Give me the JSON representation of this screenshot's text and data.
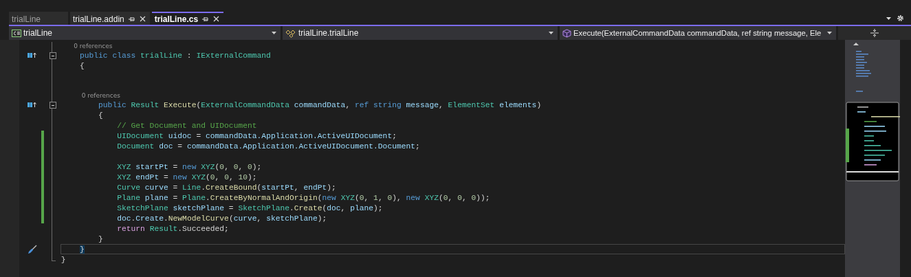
{
  "tabs": [
    {
      "label": "trialLine",
      "selected": false,
      "preview": true
    },
    {
      "label": "trialLine.addin",
      "selected": false,
      "preview": false
    },
    {
      "label": "trialLine.cs",
      "selected": true,
      "preview": false
    }
  ],
  "navigation": {
    "project": "trialLine",
    "type": "trialLine.trialLine",
    "member": "Execute(ExternalCommandData commandData, ref string message, Ele"
  },
  "code_lines": [
    {
      "kind": "codelens",
      "text": "    0 references",
      "fold": {
        "kind": "line"
      }
    },
    {
      "kind": "code",
      "gutter_icon": {
        "kind": "implements"
      },
      "fold": {
        "kind": "start"
      },
      "changed": false,
      "current": false,
      "tokens": [
        {
          "kind": "keyword",
          "text": "    public class "
        },
        {
          "kind": "type",
          "text": "trialLine"
        },
        {
          "kind": "plain",
          "text": " : "
        },
        {
          "kind": "type",
          "text": "IExternalCommand"
        }
      ]
    },
    {
      "kind": "code",
      "fold": {
        "kind": "line"
      },
      "changed": false,
      "current": false,
      "tokens": [
        {
          "kind": "plain",
          "text": "    {"
        }
      ]
    },
    {
      "kind": "code",
      "fold": {
        "kind": "line"
      },
      "changed": false,
      "current": false
    },
    {
      "kind": "code",
      "fold": {
        "kind": "line"
      },
      "changed": false,
      "current": false
    },
    {
      "kind": "codelens",
      "text": "        0 references",
      "fold": {
        "kind": "line"
      }
    },
    {
      "kind": "code",
      "gutter_icon": {
        "kind": "implements"
      },
      "fold": {
        "kind": "start"
      },
      "changed": false,
      "current": false,
      "tokens": [
        {
          "kind": "keyword",
          "text": "        public "
        },
        {
          "kind": "type",
          "text": "Result "
        },
        {
          "kind": "method",
          "text": "Execute"
        },
        {
          "kind": "plain",
          "text": "("
        },
        {
          "kind": "type",
          "text": "ExternalCommandData "
        },
        {
          "kind": "variable",
          "text": "commandData"
        },
        {
          "kind": "plain",
          "text": ", "
        },
        {
          "kind": "keyword",
          "text": "ref string "
        },
        {
          "kind": "variable",
          "text": "message"
        },
        {
          "kind": "plain",
          "text": ", "
        },
        {
          "kind": "type",
          "text": "ElementSet "
        },
        {
          "kind": "variable",
          "text": "elements"
        },
        {
          "kind": "plain",
          "text": ")"
        }
      ]
    },
    {
      "kind": "code",
      "fold": {
        "kind": "line"
      },
      "changed": false,
      "current": false,
      "tokens": [
        {
          "kind": "plain",
          "text": "        {"
        }
      ]
    },
    {
      "kind": "code",
      "fold": {
        "kind": "line"
      },
      "changed": false,
      "current": false,
      "tokens": [
        {
          "kind": "comment",
          "text": "            // Get Document and UIDocument"
        }
      ]
    },
    {
      "kind": "code",
      "fold": {
        "kind": "line"
      },
      "changed": true,
      "current": false,
      "tokens": [
        {
          "kind": "type",
          "text": "            UIDocument "
        },
        {
          "kind": "variable",
          "text": "uidoc"
        },
        {
          "kind": "plain",
          "text": " = "
        },
        {
          "kind": "variable",
          "text": "commandData.Application.ActiveUIDocument"
        },
        {
          "kind": "plain",
          "text": ";"
        }
      ]
    },
    {
      "kind": "code",
      "fold": {
        "kind": "line"
      },
      "changed": true,
      "current": false,
      "tokens": [
        {
          "kind": "type",
          "text": "            Document "
        },
        {
          "kind": "variable",
          "text": "doc"
        },
        {
          "kind": "plain",
          "text": " = "
        },
        {
          "kind": "variable",
          "text": "commandData.Application.ActiveUIDocument.Document"
        },
        {
          "kind": "plain",
          "text": ";"
        }
      ]
    },
    {
      "kind": "code",
      "fold": {
        "kind": "line"
      },
      "changed": true,
      "current": false
    },
    {
      "kind": "code",
      "fold": {
        "kind": "line"
      },
      "changed": true,
      "current": false,
      "tokens": [
        {
          "kind": "type",
          "text": "            XYZ "
        },
        {
          "kind": "variable",
          "text": "startPt"
        },
        {
          "kind": "plain",
          "text": " = "
        },
        {
          "kind": "keyword",
          "text": "new "
        },
        {
          "kind": "type",
          "text": "XYZ"
        },
        {
          "kind": "plain",
          "text": "("
        },
        {
          "kind": "number",
          "text": "0"
        },
        {
          "kind": "plain",
          "text": ", "
        },
        {
          "kind": "number",
          "text": "0"
        },
        {
          "kind": "plain",
          "text": ", "
        },
        {
          "kind": "number",
          "text": "0"
        },
        {
          "kind": "plain",
          "text": ");"
        }
      ]
    },
    {
      "kind": "code",
      "fold": {
        "kind": "line"
      },
      "changed": true,
      "current": false,
      "tokens": [
        {
          "kind": "type",
          "text": "            XYZ "
        },
        {
          "kind": "variable",
          "text": "endPt"
        },
        {
          "kind": "plain",
          "text": " = "
        },
        {
          "kind": "keyword",
          "text": "new "
        },
        {
          "kind": "type",
          "text": "XYZ"
        },
        {
          "kind": "plain",
          "text": "("
        },
        {
          "kind": "number",
          "text": "0"
        },
        {
          "kind": "plain",
          "text": ", "
        },
        {
          "kind": "number",
          "text": "0"
        },
        {
          "kind": "plain",
          "text": ", "
        },
        {
          "kind": "number",
          "text": "10"
        },
        {
          "kind": "plain",
          "text": ");"
        }
      ]
    },
    {
      "kind": "code",
      "fold": {
        "kind": "line"
      },
      "changed": true,
      "current": false,
      "tokens": [
        {
          "kind": "type",
          "text": "            Curve "
        },
        {
          "kind": "variable",
          "text": "curve"
        },
        {
          "kind": "plain",
          "text": " = "
        },
        {
          "kind": "type",
          "text": "Line"
        },
        {
          "kind": "plain",
          "text": "."
        },
        {
          "kind": "method",
          "text": "CreateBound"
        },
        {
          "kind": "plain",
          "text": "("
        },
        {
          "kind": "variable",
          "text": "startPt"
        },
        {
          "kind": "plain",
          "text": ", "
        },
        {
          "kind": "variable",
          "text": "endPt"
        },
        {
          "kind": "plain",
          "text": ");"
        }
      ]
    },
    {
      "kind": "code",
      "fold": {
        "kind": "line"
      },
      "changed": true,
      "current": false,
      "tokens": [
        {
          "kind": "type",
          "text": "            Plane "
        },
        {
          "kind": "variable",
          "text": "plane"
        },
        {
          "kind": "plain",
          "text": " = "
        },
        {
          "kind": "type",
          "text": "Plane"
        },
        {
          "kind": "plain",
          "text": "."
        },
        {
          "kind": "method",
          "text": "CreateByNormalAndOrigin"
        },
        {
          "kind": "plain",
          "text": "("
        },
        {
          "kind": "keyword",
          "text": "new "
        },
        {
          "kind": "type",
          "text": "XYZ"
        },
        {
          "kind": "plain",
          "text": "("
        },
        {
          "kind": "number",
          "text": "0"
        },
        {
          "kind": "plain",
          "text": ", "
        },
        {
          "kind": "number",
          "text": "1"
        },
        {
          "kind": "plain",
          "text": ", "
        },
        {
          "kind": "number",
          "text": "0"
        },
        {
          "kind": "plain",
          "text": "), "
        },
        {
          "kind": "keyword",
          "text": "new "
        },
        {
          "kind": "type",
          "text": "XYZ"
        },
        {
          "kind": "plain",
          "text": "("
        },
        {
          "kind": "number",
          "text": "0"
        },
        {
          "kind": "plain",
          "text": ", "
        },
        {
          "kind": "number",
          "text": "0"
        },
        {
          "kind": "plain",
          "text": ", "
        },
        {
          "kind": "number",
          "text": "0"
        },
        {
          "kind": "plain",
          "text": "));"
        }
      ]
    },
    {
      "kind": "code",
      "fold": {
        "kind": "line"
      },
      "changed": true,
      "current": false,
      "tokens": [
        {
          "kind": "type",
          "text": "            SketchPlane "
        },
        {
          "kind": "variable",
          "text": "sketchPlane"
        },
        {
          "kind": "plain",
          "text": " = "
        },
        {
          "kind": "type",
          "text": "SketchPlane"
        },
        {
          "kind": "plain",
          "text": "."
        },
        {
          "kind": "method",
          "text": "Create"
        },
        {
          "kind": "plain",
          "text": "("
        },
        {
          "kind": "variable",
          "text": "doc"
        },
        {
          "kind": "plain",
          "text": ", "
        },
        {
          "kind": "variable",
          "text": "plane"
        },
        {
          "kind": "plain",
          "text": ");"
        }
      ]
    },
    {
      "kind": "code",
      "fold": {
        "kind": "line"
      },
      "changed": true,
      "current": false,
      "tokens": [
        {
          "kind": "variable",
          "text": "            doc"
        },
        {
          "kind": "plain",
          "text": "."
        },
        {
          "kind": "variable",
          "text": "Create"
        },
        {
          "kind": "plain",
          "text": "."
        },
        {
          "kind": "method",
          "text": "NewModelCurve"
        },
        {
          "kind": "plain",
          "text": "("
        },
        {
          "kind": "variable",
          "text": "curve"
        },
        {
          "kind": "plain",
          "text": ", "
        },
        {
          "kind": "variable",
          "text": "sketchPlane"
        },
        {
          "kind": "plain",
          "text": ");"
        }
      ]
    },
    {
      "kind": "code",
      "fold": {
        "kind": "line"
      },
      "changed": false,
      "current": false,
      "tokens": [
        {
          "kind": "control",
          "text": "            return "
        },
        {
          "kind": "type",
          "text": "Result"
        },
        {
          "kind": "plain",
          "text": ".Succeeded;"
        }
      ]
    },
    {
      "kind": "code",
      "fold": {
        "kind": "line"
      },
      "changed": false,
      "current": false,
      "tokens": [
        {
          "kind": "plain",
          "text": "        }"
        }
      ]
    },
    {
      "kind": "code",
      "gutter_icon": {
        "kind": "brush"
      },
      "fold": {
        "kind": "line"
      },
      "changed": false,
      "current": true,
      "tokens": [
        {
          "kind": "brace",
          "text": "    }"
        }
      ]
    },
    {
      "kind": "code",
      "fold": {
        "kind": "end"
      },
      "changed": false,
      "current": false,
      "tokens": [
        {
          "kind": "plain",
          "text": "}"
        }
      ]
    }
  ]
}
